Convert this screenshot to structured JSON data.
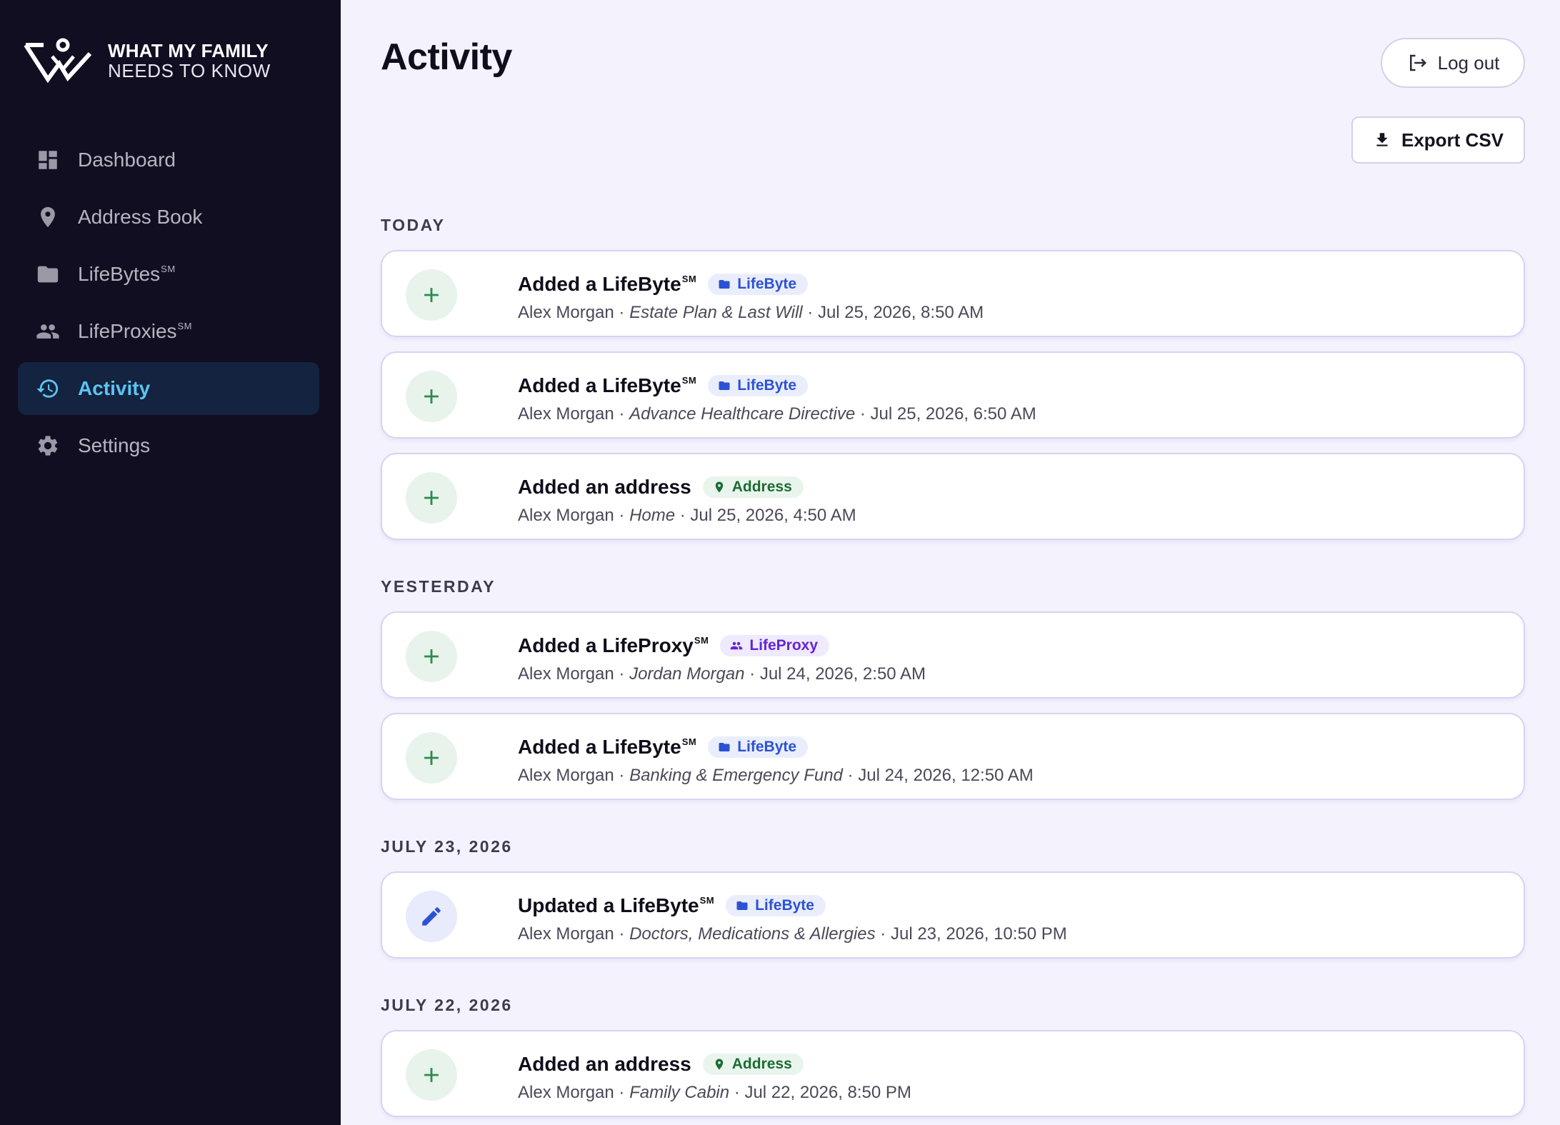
{
  "brand": {
    "line1": "WHAT MY FAMILY",
    "line2": "NEEDS TO KNOW"
  },
  "nav": [
    {
      "label": "Dashboard",
      "sup": "",
      "icon": "dashboard-icon",
      "active": false
    },
    {
      "label": "Address Book",
      "sup": "",
      "icon": "location-pin-icon",
      "active": false
    },
    {
      "label": "LifeBytes",
      "sup": "SM",
      "icon": "folder-icon",
      "active": false
    },
    {
      "label": "LifeProxies",
      "sup": "SM",
      "icon": "people-icon",
      "active": false
    },
    {
      "label": "Activity",
      "sup": "",
      "icon": "history-icon",
      "active": true
    },
    {
      "label": "Settings",
      "sup": "",
      "icon": "gear-icon",
      "active": false
    }
  ],
  "page": {
    "title": "Activity",
    "logout_label": "Log out",
    "export_label": "Export CSV"
  },
  "sections": [
    {
      "label": "TODAY"
    },
    {
      "label": "YESTERDAY"
    },
    {
      "label": "JULY 23, 2026"
    },
    {
      "label": "JULY 22, 2026"
    }
  ],
  "activities": [
    {
      "action": "Added a LifeByte",
      "sup": "SM",
      "type": "add",
      "badge": "LifeByte",
      "badge_kind": "lifebyte",
      "user": "Alex Morgan",
      "object": "Estate Plan & Last Will",
      "time": "Jul 25, 2026, 8:50 AM"
    },
    {
      "action": "Added a LifeByte",
      "sup": "SM",
      "type": "add",
      "badge": "LifeByte",
      "badge_kind": "lifebyte",
      "user": "Alex Morgan",
      "object": "Advance Healthcare Directive",
      "time": "Jul 25, 2026, 6:50 AM"
    },
    {
      "action": "Added an address",
      "sup": "",
      "type": "add",
      "badge": "Address",
      "badge_kind": "address",
      "user": "Alex Morgan",
      "object": "Home",
      "time": "Jul 25, 2026, 4:50 AM"
    },
    {
      "action": "Added a LifeProxy",
      "sup": "SM",
      "type": "add",
      "badge": "LifeProxy",
      "badge_kind": "lifeproxy",
      "user": "Alex Morgan",
      "object": "Jordan Morgan",
      "time": "Jul 24, 2026, 2:50 AM"
    },
    {
      "action": "Added a LifeByte",
      "sup": "SM",
      "type": "add",
      "badge": "LifeByte",
      "badge_kind": "lifebyte",
      "user": "Alex Morgan",
      "object": "Banking & Emergency Fund",
      "time": "Jul 24, 2026, 12:50 AM"
    },
    {
      "action": "Updated a LifeByte",
      "sup": "SM",
      "type": "edit",
      "badge": "LifeByte",
      "badge_kind": "lifebyte",
      "user": "Alex Morgan",
      "object": "Doctors, Medications & Allergies",
      "time": "Jul 23, 2026, 10:50 PM"
    },
    {
      "action": "Added an address",
      "sup": "",
      "type": "add",
      "badge": "Address",
      "badge_kind": "address",
      "user": "Alex Morgan",
      "object": "Family Cabin",
      "time": "Jul 22, 2026, 8:50 PM"
    }
  ],
  "colors": {
    "sidebar_bg": "#120e22",
    "active_accent": "#5cc4f2",
    "page_bg": "#f4f2fd",
    "add_icon": "#2e8a4e",
    "edit_icon": "#2c52d4"
  }
}
